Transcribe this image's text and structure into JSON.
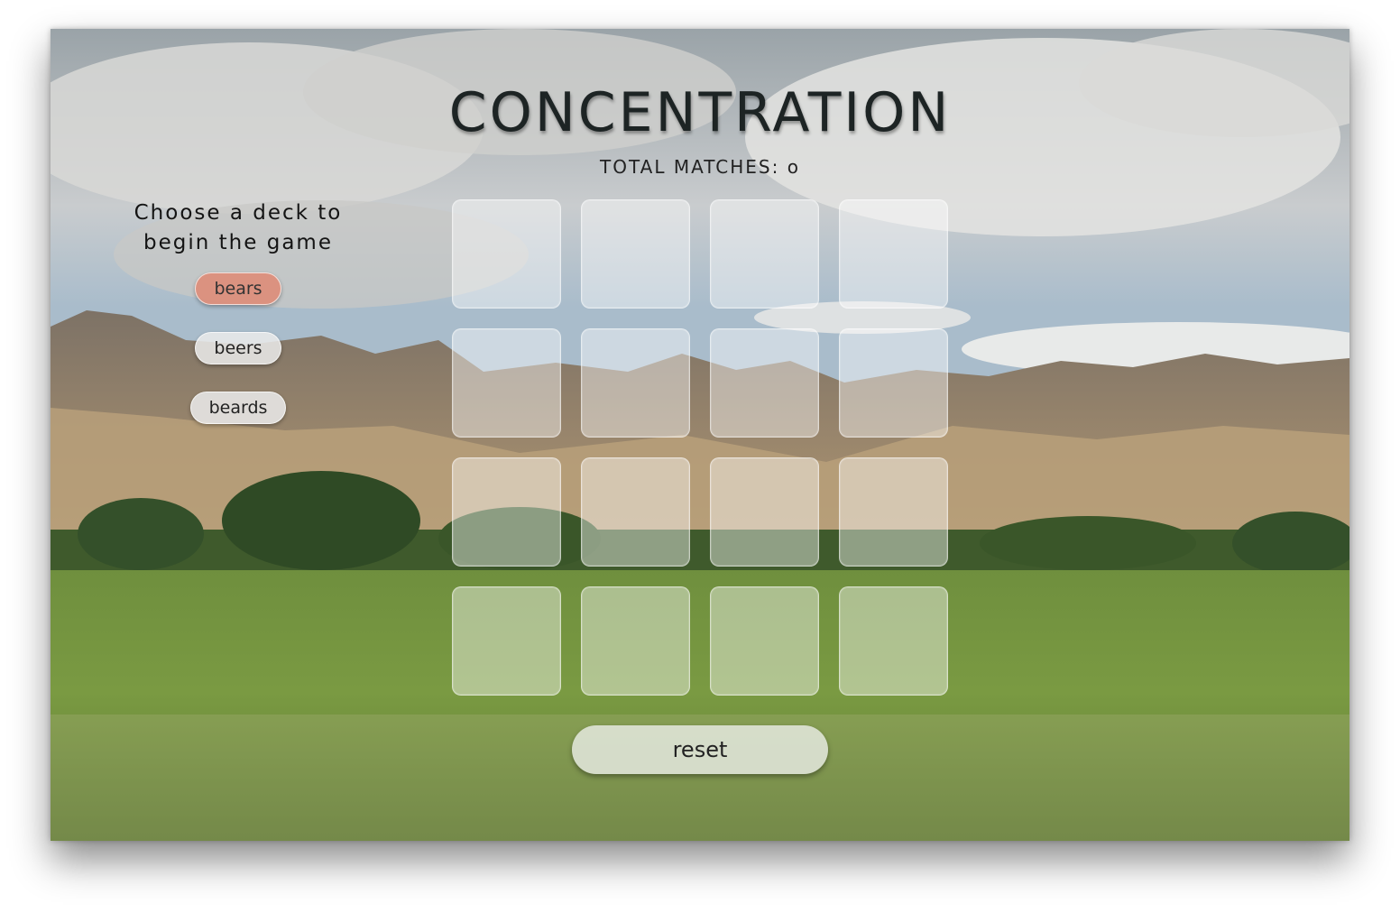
{
  "header": {
    "title": "CONCENTRATION",
    "matches_label": "TOTAL MATCHES: o"
  },
  "chooser": {
    "prompt_line1": "Choose a deck to",
    "prompt_line2": "begin the game",
    "decks": [
      {
        "label": "bears",
        "selected": true
      },
      {
        "label": "beers",
        "selected": false
      },
      {
        "label": "beards",
        "selected": false
      }
    ]
  },
  "board": {
    "rows": 4,
    "columns": 4,
    "face_down_cards": 16
  },
  "controls": {
    "reset_label": "reset"
  },
  "colors": {
    "selected_deck": "#de8c78",
    "title_text": "#1d2424"
  }
}
